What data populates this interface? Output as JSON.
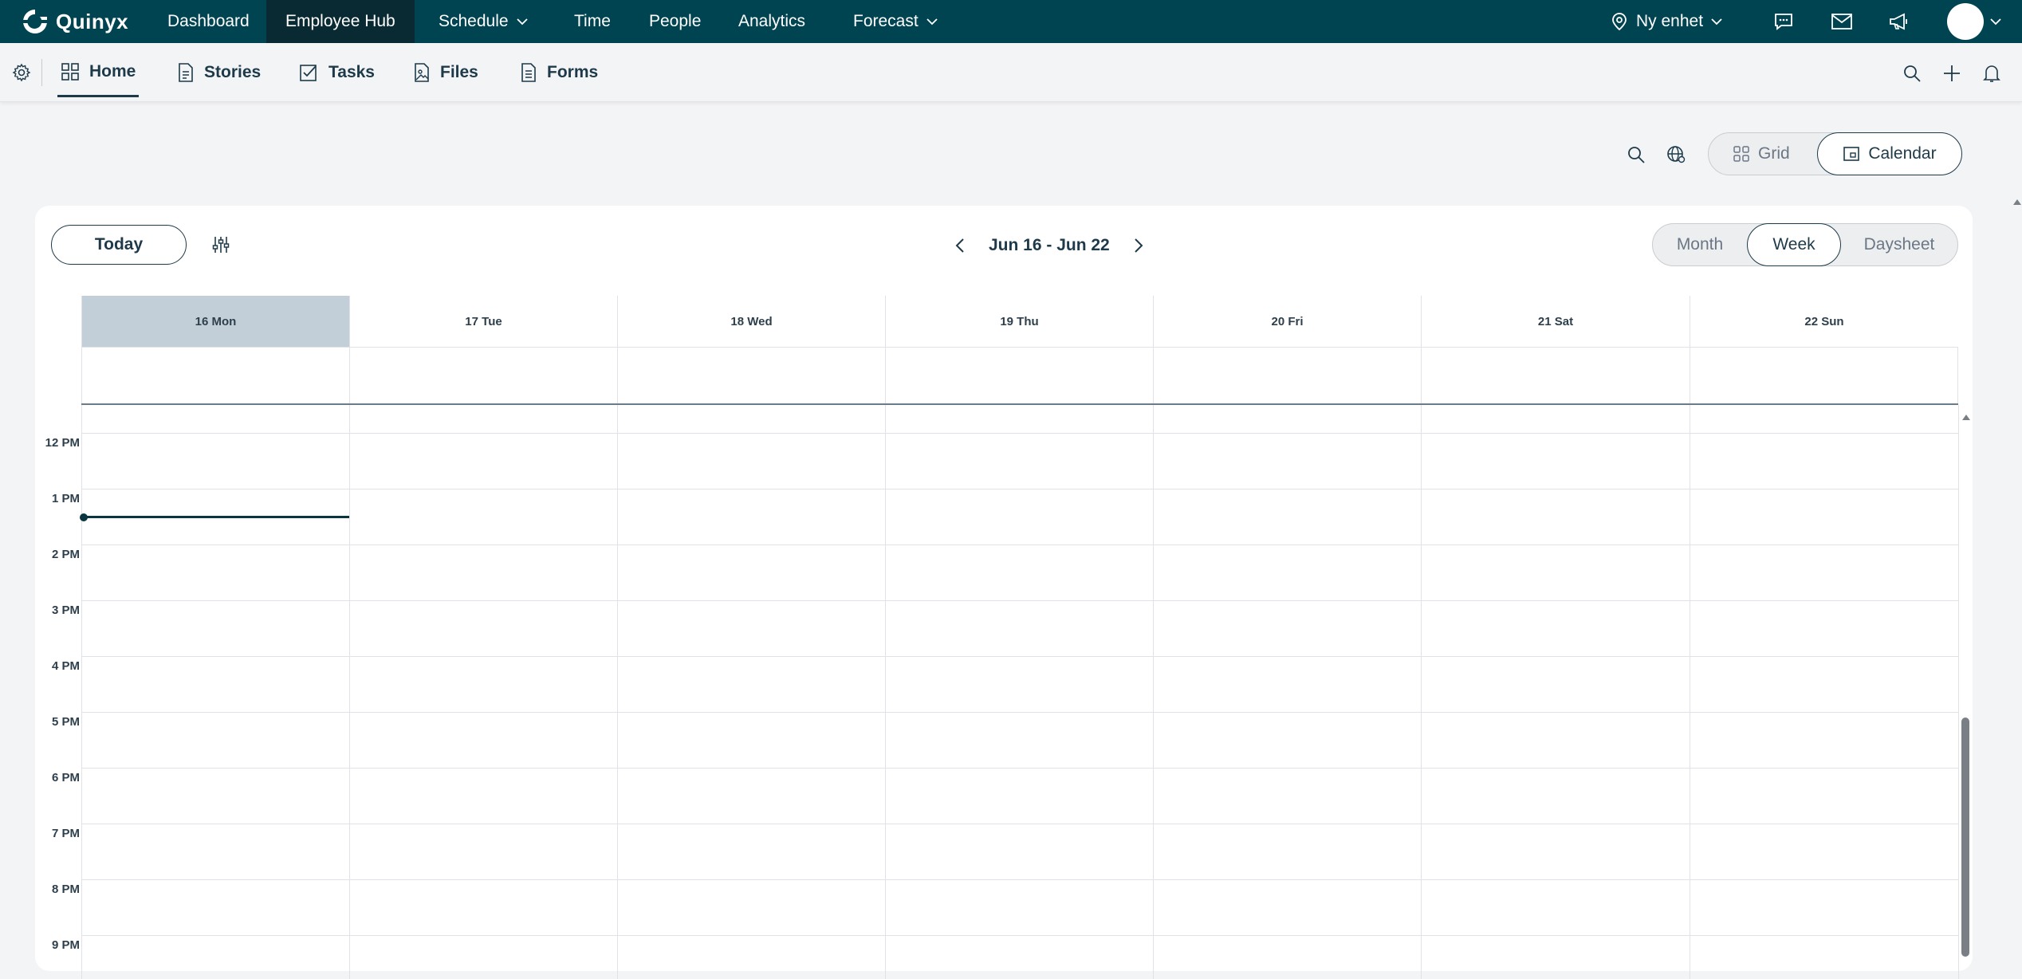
{
  "app": {
    "name": "Quinyx"
  },
  "topnav": {
    "items": [
      {
        "label": "Dashboard",
        "active": false,
        "dropdown": false
      },
      {
        "label": "Employee Hub",
        "active": true,
        "dropdown": false
      },
      {
        "label": "Schedule",
        "active": false,
        "dropdown": true
      },
      {
        "label": "Time",
        "active": false,
        "dropdown": false
      },
      {
        "label": "People",
        "active": false,
        "dropdown": false
      },
      {
        "label": "Analytics",
        "active": false,
        "dropdown": false
      },
      {
        "label": "Forecast",
        "active": false,
        "dropdown": true
      }
    ],
    "unit": "Ny enhet",
    "icons": [
      "location-pin-icon",
      "chat-icon",
      "mail-icon",
      "megaphone-icon"
    ]
  },
  "subnav": {
    "items": [
      {
        "label": "Home",
        "icon": "grid-icon",
        "active": true
      },
      {
        "label": "Stories",
        "icon": "document-icon",
        "active": false
      },
      {
        "label": "Tasks",
        "icon": "task-check-icon",
        "active": false
      },
      {
        "label": "Files",
        "icon": "file-image-icon",
        "active": false
      },
      {
        "label": "Forms",
        "icon": "form-icon",
        "active": false
      }
    ],
    "right_icons": [
      "search-icon",
      "plus-icon",
      "bell-icon"
    ]
  },
  "view_toggle": {
    "options": [
      {
        "label": "Grid",
        "icon": "grid-icon",
        "selected": false
      },
      {
        "label": "Calendar",
        "icon": "calendar-icon",
        "selected": true
      }
    ]
  },
  "calendar": {
    "today_label": "Today",
    "date_range": "Jun 16 - Jun 22",
    "periods": [
      {
        "label": "Month",
        "selected": false
      },
      {
        "label": "Week",
        "selected": true
      },
      {
        "label": "Daysheet",
        "selected": false
      }
    ],
    "days": [
      {
        "label": "16 Mon",
        "today": true
      },
      {
        "label": "17 Tue",
        "today": false
      },
      {
        "label": "18 Wed",
        "today": false
      },
      {
        "label": "19 Thu",
        "today": false
      },
      {
        "label": "20 Fri",
        "today": false
      },
      {
        "label": "21 Sat",
        "today": false
      },
      {
        "label": "22 Sun",
        "today": false
      }
    ],
    "hours": [
      "12 PM",
      "1 PM",
      "2 PM",
      "3 PM",
      "4 PM",
      "5 PM",
      "6 PM",
      "7 PM",
      "8 PM",
      "9 PM"
    ]
  }
}
